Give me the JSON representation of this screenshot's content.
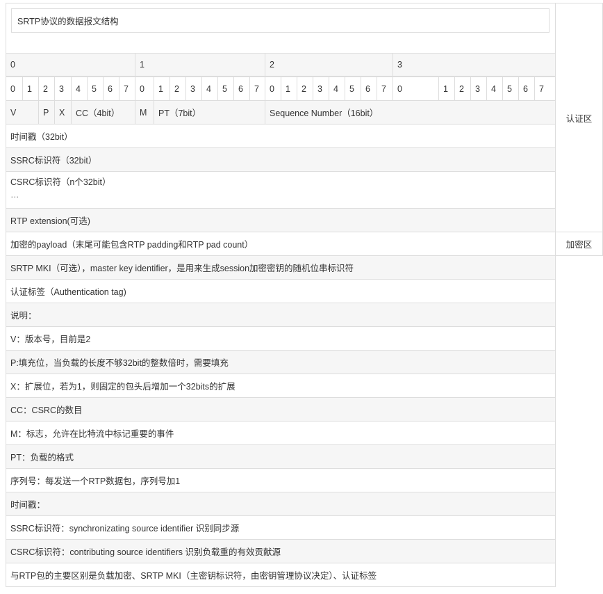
{
  "title": "SRTP协议的数据报文结构",
  "octet_header": [
    "0",
    "1",
    "2",
    "3"
  ],
  "bits": [
    "0",
    "1",
    "2",
    "3",
    "4",
    "5",
    "6",
    "7",
    "0",
    "1",
    "2",
    "3",
    "4",
    "5",
    "6",
    "7",
    "0",
    "1",
    "2",
    "3",
    "4",
    "5",
    "6",
    "7",
    "0",
    "1",
    "2",
    "3",
    "4",
    "5",
    "6",
    "7"
  ],
  "header_fields": {
    "v": "V",
    "p": "P",
    "x": "X",
    "cc": "CC（4bit）",
    "m": "M",
    "pt": "PT（7bit）",
    "seq": "Sequence Number（16bit）"
  },
  "rows": {
    "timestamp": "时间戳（32bit）",
    "ssrc": "SSRC标识符（32bit）",
    "csrc_line1": "CSRC标识符（n个32bit）",
    "csrc_line2": "…",
    "rtp_ext": "RTP extension(可选)",
    "payload": "加密的payload（末尾可能包含RTP padding和RTP pad count）",
    "mki": "SRTP MKI（可选），master key identifier，是用来生成session加密密钥的随机位串标识符",
    "auth_tag": "认证标签（Authentication tag)"
  },
  "side_labels": {
    "auth_area": "认证区",
    "enc_area": "加密区"
  },
  "notes": [
    "说明：",
    "V：版本号，目前是2",
    "P:填充位，当负载的长度不够32bit的整数倍时，需要填充",
    "X：扩展位，若为1，则固定的包头后增加一个32bits的扩展",
    "CC：CSRC的数目",
    "M：标志，允许在比特流中标记重要的事件",
    "PT：负载的格式",
    "序列号：每发送一个RTP数据包，序列号加1",
    "时间戳：",
    "SSRC标识符：synchronizating source identifier 识别同步源",
    "CSRC标识符：contributing source identifiers 识别负载重的有效贡献源",
    "与RTP包的主要区别是负载加密、SRTP MKI（主密钥标识符，由密钥管理协议决定）、认证标签"
  ]
}
